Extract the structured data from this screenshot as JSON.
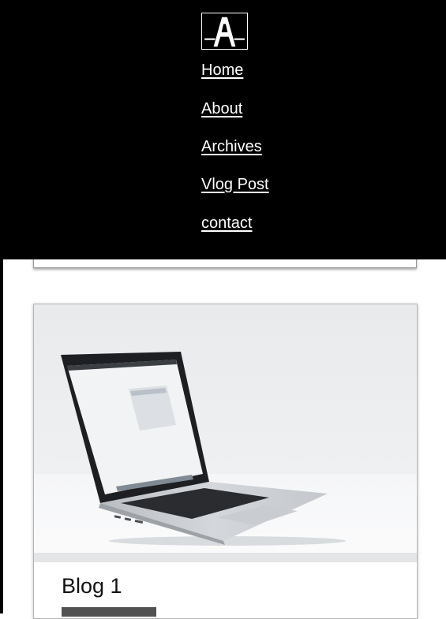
{
  "nav": {
    "logo_alt": "A",
    "links": [
      {
        "label": "Home"
      },
      {
        "label": "About"
      },
      {
        "label": "Archives"
      },
      {
        "label": "Vlog Post"
      },
      {
        "label": "contact"
      }
    ]
  },
  "posts": [
    {
      "title": "Blog 1"
    }
  ],
  "colors": {
    "nav_background": "#000000",
    "nav_text": "#ffffff",
    "page_background": "#ffffff",
    "title_text": "#111111"
  },
  "icons": {
    "logo": "a-letter-logo-icon",
    "post_image": "laptop-photo"
  }
}
